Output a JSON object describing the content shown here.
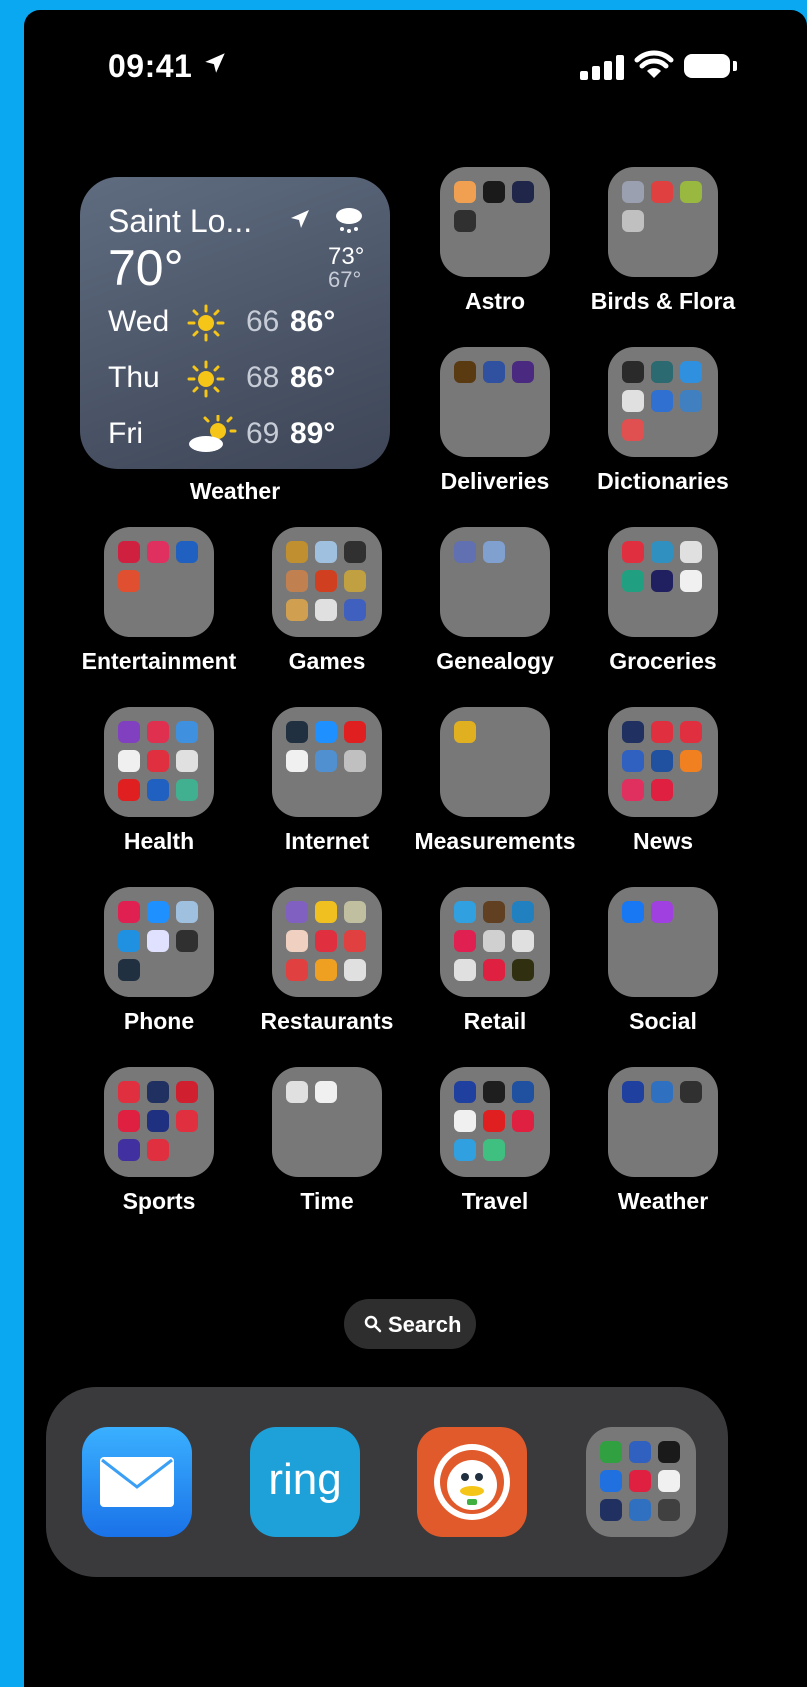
{
  "status_bar": {
    "time": "09:41"
  },
  "weather_widget": {
    "city": "Saint Lo...",
    "current_temp": "70°",
    "high": "73°",
    "low": "67°",
    "forecast": [
      {
        "day": "Wed",
        "icon": "sun-icon",
        "low": "66",
        "high": "86°"
      },
      {
        "day": "Thu",
        "icon": "sun-icon",
        "low": "68",
        "high": "86°"
      },
      {
        "day": "Fri",
        "icon": "partly-cloudy-icon",
        "low": "69",
        "high": "89°"
      }
    ],
    "label": "Weather"
  },
  "folders": [
    {
      "label": "Astro",
      "apps": [
        "#f0a050",
        "#1a1a1a",
        "#20254a",
        "#303030"
      ]
    },
    {
      "label": "Birds & Flora",
      "apps": [
        "#9aa0b0",
        "#e04040",
        "#98b840",
        "#c0c0c0"
      ]
    },
    {
      "label": "Deliveries",
      "apps": [
        "#5a3a10",
        "#3050a0",
        "#4a2a80"
      ]
    },
    {
      "label": "Dictionaries",
      "apps": [
        "#2a2a2a",
        "#2a6a70",
        "#3090e0",
        "#e0e0e0",
        "#3070d0",
        "#4080c0",
        "#e05050"
      ]
    },
    {
      "label": "Entertainment",
      "apps": [
        "#d02040",
        "#e03060",
        "#2060c0",
        "#e05030"
      ]
    },
    {
      "label": "Games",
      "apps": [
        "#c09030",
        "#a0c0e0",
        "#303030",
        "#c08050",
        "#d04020",
        "#c0a040",
        "#d0a050",
        "#e0e0e0",
        "#4060c0"
      ]
    },
    {
      "label": "Genealogy",
      "apps": [
        "#6070b0",
        "#80a0d0"
      ]
    },
    {
      "label": "Groceries",
      "apps": [
        "#e03040",
        "#3090c0",
        "#e0e0e0",
        "#20a080",
        "#202060",
        "#f0f0f0"
      ]
    },
    {
      "label": "Health",
      "apps": [
        "#8040c0",
        "#e03050",
        "#4090e0",
        "#f0f0f0",
        "#e03040",
        "#e0e0e0",
        "#e02020",
        "#2060c0",
        "#40b090"
      ]
    },
    {
      "label": "Internet",
      "apps": [
        "#203040",
        "#1e90ff",
        "#e02020",
        "#f0f0f0",
        "#5090d0",
        "#c0c0c0"
      ]
    },
    {
      "label": "Measurements",
      "apps": [
        "#e0b020"
      ]
    },
    {
      "label": "News",
      "apps": [
        "#203060",
        "#e03040",
        "#e03040",
        "#3060c0",
        "#2050a0",
        "#f08020",
        "#e03060",
        "#e02040"
      ]
    },
    {
      "label": "Phone",
      "apps": [
        "#e02050",
        "#1e90ff",
        "#a0c0e0",
        "#2090e0",
        "#e0e0ff",
        "#303030",
        "#203040"
      ]
    },
    {
      "label": "Restaurants",
      "apps": [
        "#8060c0",
        "#f0c020",
        "#c0c0a0",
        "#f0d0c0",
        "#e03040",
        "#e04040",
        "#e04040",
        "#f0a020",
        "#e0e0e0"
      ]
    },
    {
      "label": "Retail",
      "apps": [
        "#30a0e0",
        "#604020",
        "#2080c0",
        "#e02050",
        "#d0d0d0",
        "#e0e0e0",
        "#e0e0e0",
        "#e02040",
        "#303010"
      ]
    },
    {
      "label": "Social",
      "apps": [
        "#1877f2",
        "#a040e0"
      ]
    },
    {
      "label": "Sports",
      "apps": [
        "#e03040",
        "#203060",
        "#d02030",
        "#e02040",
        "#203080",
        "#e03040",
        "#4030a0",
        "#e03040"
      ]
    },
    {
      "label": "Time",
      "apps": [
        "#e0e0e0",
        "#f0f0f0"
      ]
    },
    {
      "label": "Travel",
      "apps": [
        "#2040a0",
        "#1e1e1e",
        "#2050a0",
        "#f0f0f0",
        "#e02020",
        "#e02040",
        "#30a0e0",
        "#40c080"
      ]
    },
    {
      "label": "Weather",
      "apps": [
        "#2040a0",
        "#3070c0",
        "#303030"
      ]
    }
  ],
  "search": {
    "label": "Search"
  },
  "dock": {
    "apps": [
      {
        "name": "mail-app-icon"
      },
      {
        "name": "ring-app-icon",
        "text": "ring"
      },
      {
        "name": "duckduckgo-app-icon"
      },
      {
        "name": "dock-folder",
        "apps": [
          "#30a040",
          "#3060c0",
          "#1a1a1a",
          "#2070e0",
          "#e02040",
          "#f0f0f0",
          "#203060",
          "#3070c0",
          "#404040"
        ]
      }
    ]
  }
}
